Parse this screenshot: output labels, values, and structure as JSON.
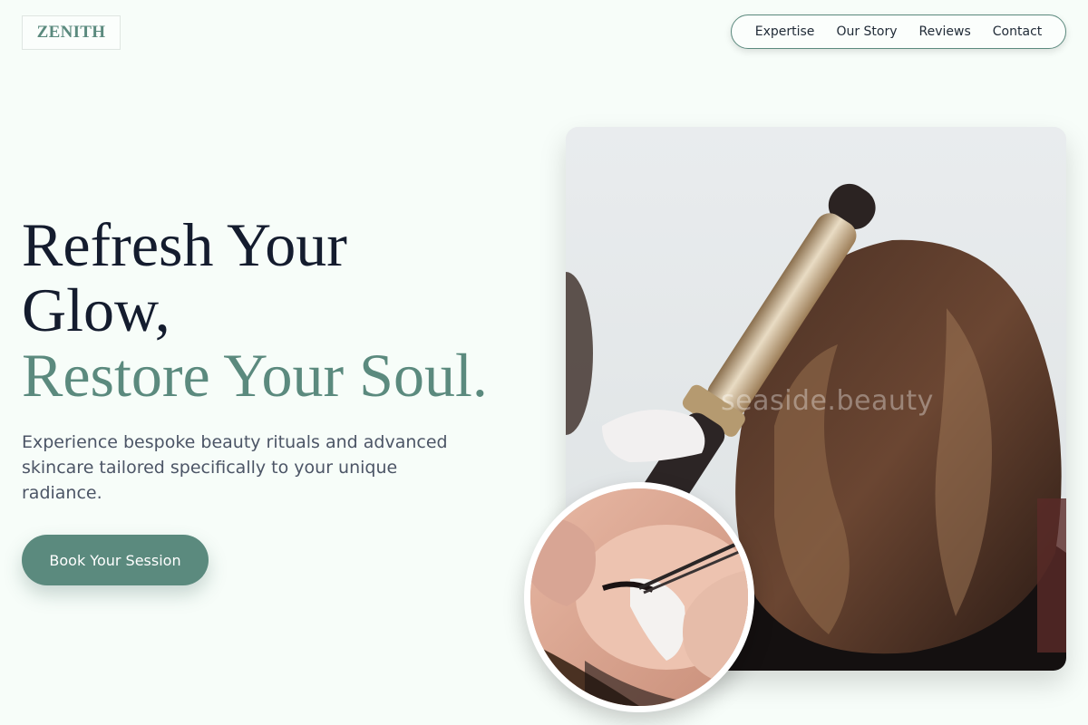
{
  "brand": {
    "logo_text": "ZENITH"
  },
  "nav": {
    "items": [
      "Expertise",
      "Our Story",
      "Reviews",
      "Contact"
    ]
  },
  "hero": {
    "headline_line1": "Refresh Your",
    "headline_line2": "Glow,",
    "headline_accent": "Restore Your Soul.",
    "subtext": "Experience bespoke beauty rituals and advanced skincare tailored specifically to your unique radiance.",
    "cta_label": "Book Your Session"
  },
  "media": {
    "watermark": "seaside.beauty"
  },
  "colors": {
    "accent": "#5b8a7e",
    "background": "#f7fdf9",
    "heading": "#141c2e",
    "body_text": "#4c5566"
  }
}
